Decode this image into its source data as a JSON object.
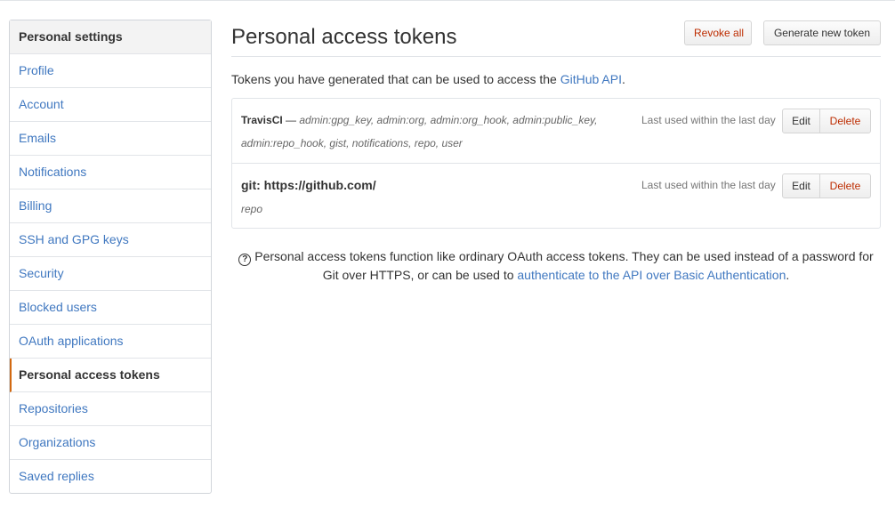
{
  "sidebar": {
    "header": "Personal settings",
    "items": [
      {
        "label": "Profile"
      },
      {
        "label": "Account"
      },
      {
        "label": "Emails"
      },
      {
        "label": "Notifications"
      },
      {
        "label": "Billing"
      },
      {
        "label": "SSH and GPG keys"
      },
      {
        "label": "Security"
      },
      {
        "label": "Blocked users"
      },
      {
        "label": "OAuth applications"
      },
      {
        "label": "Personal access tokens",
        "selected": true
      },
      {
        "label": "Repositories"
      },
      {
        "label": "Organizations"
      },
      {
        "label": "Saved replies"
      }
    ]
  },
  "main": {
    "title": "Personal access tokens",
    "revoke_all_label": "Revoke all",
    "generate_label": "Generate new token",
    "intro_text": "Tokens you have generated that can be used to access the ",
    "intro_link": "GitHub API",
    "intro_end": ".",
    "tokens": [
      {
        "name": "TravisCI",
        "separator": " — ",
        "scopes": "admin:gpg_key, admin:org, admin:org_hook, admin:public_key, admin:repo_hook, gist, notifications, repo, user",
        "last_used": "Last used within the last day",
        "edit_label": "Edit",
        "delete_label": "Delete"
      },
      {
        "name": "git: https://github.com/",
        "scopes": "repo",
        "last_used": "Last used within the last day",
        "edit_label": "Edit",
        "delete_label": "Delete"
      }
    ],
    "help": {
      "icon": "?",
      "text_before": "Personal access tokens function like ordinary OAuth access tokens. They can be used instead of a password for Git over HTTPS, or can be used to ",
      "link": "authenticate to the API over Basic Authentication",
      "text_after": "."
    }
  },
  "colors": {
    "link": "#4078c0",
    "danger": "#bd2c00",
    "selected_border": "#d26911"
  }
}
